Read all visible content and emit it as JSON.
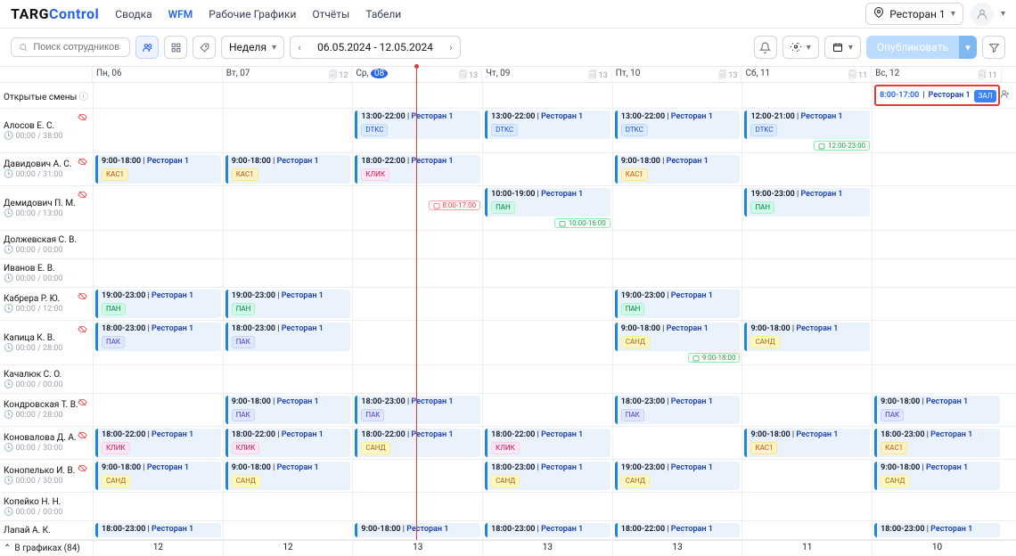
{
  "brand_main": "TARG",
  "brand_accent": "Control",
  "nav": [
    "Сводка",
    "WFM",
    "Рабочие Графики",
    "Отчёты",
    "Табели"
  ],
  "active_nav": 1,
  "location": "Ресторан 1",
  "search_placeholder": "Поиск сотрудников",
  "period_label": "Неделя",
  "date_range": "06.05.2024 - 12.05.2024",
  "publish_label": "Опубликовать",
  "day_headers": [
    {
      "label": "Пн, 06",
      "count": ""
    },
    {
      "label": "Вт, 07",
      "count": "12"
    },
    {
      "label": "Ср, 08",
      "count": "13",
      "today": true
    },
    {
      "label": "Чт, 09",
      "count": "13"
    },
    {
      "label": "Пт, 10",
      "count": "13"
    },
    {
      "label": "Сб, 11",
      "count": "11"
    },
    {
      "label": "Вс, 12",
      "count": "11"
    }
  ],
  "open_shifts_label": "Открытые смены",
  "open_shift": {
    "time": "8:00-17:00",
    "loc": "Ресторан 1",
    "tag": "ЗАЛ"
  },
  "footer_label": "В графиках (84)",
  "footer_counts": [
    "12",
    "12",
    "13",
    "13",
    "13",
    "11",
    "10"
  ],
  "employees": [
    {
      "name": "Алосов Е. С.",
      "hours": "00:00 / 38:00",
      "eye": true,
      "shifts": [
        null,
        null,
        {
          "t": "13:00-22:00",
          "tag": "DTKC"
        },
        {
          "t": "13:00-22:00",
          "tag": "DTKC"
        },
        {
          "t": "13:00-22:00",
          "tag": "DTKC"
        },
        {
          "t": "12:00-21:00",
          "tag": "DTKC",
          "note": "12:00-23:00",
          "note_kind": "green"
        },
        null
      ]
    },
    {
      "name": "Давидович А. С.",
      "hours": "00:00 / 31:00",
      "eye": true,
      "shifts": [
        {
          "t": "9:00-18:00",
          "tag": "КАС1"
        },
        {
          "t": "9:00-18:00",
          "tag": "КАС1"
        },
        {
          "t": "18:00-22:00",
          "tag": "КЛИК"
        },
        null,
        {
          "t": "9:00-18:00",
          "tag": "КАС1"
        },
        null,
        null
      ]
    },
    {
      "name": "Демидович П. М.",
      "hours": "00:00 / 13:00",
      "eye": true,
      "shifts": [
        null,
        null,
        {
          "note_only": "8:00-17:00",
          "note_kind": "red"
        },
        {
          "t": "10:00-19:00",
          "tag": "ПАН",
          "note": "10:00-16:00",
          "note_kind": "green"
        },
        null,
        {
          "t": "19:00-23:00",
          "tag": "ПАН"
        },
        null
      ]
    },
    {
      "name": "Должевская С. В.",
      "hours": "00:00 / 00:00",
      "shifts": [
        null,
        null,
        null,
        null,
        null,
        null,
        null
      ]
    },
    {
      "name": "Иванов Е. В.",
      "hours": "00:00 / 00:00",
      "shifts": [
        null,
        null,
        null,
        null,
        null,
        null,
        null
      ]
    },
    {
      "name": "Кабрера Р. Ю.",
      "hours": "00:00 / 12:00",
      "eye": true,
      "shifts": [
        {
          "t": "19:00-23:00",
          "tag": "ПАН"
        },
        {
          "t": "19:00-23:00",
          "tag": "ПАН"
        },
        null,
        null,
        {
          "t": "19:00-23:00",
          "tag": "ПАН"
        },
        null,
        null
      ]
    },
    {
      "name": "Капица К. В.",
      "hours": "00:00 / 28:00",
      "eye": true,
      "shifts": [
        {
          "t": "18:00-23:00",
          "tag": "ПАК"
        },
        {
          "t": "18:00-23:00",
          "tag": "ПАК"
        },
        null,
        null,
        {
          "t": "9:00-18:00",
          "tag": "САНД",
          "note": "9:00-18:00",
          "note_kind": "green"
        },
        {
          "t": "9:00-18:00",
          "tag": "САНД"
        },
        null
      ]
    },
    {
      "name": "Качалюк С. О.",
      "hours": "00:00 / 00:00",
      "shifts": [
        null,
        null,
        null,
        null,
        null,
        null,
        null
      ]
    },
    {
      "name": "Кондровская Т. В.",
      "hours": "00:00 / 28:00",
      "eye": true,
      "shifts": [
        null,
        {
          "t": "9:00-18:00",
          "tag": "ПАК"
        },
        {
          "t": "18:00-23:00",
          "tag": "ПАК"
        },
        null,
        {
          "t": "18:00-23:00",
          "tag": "ПАК"
        },
        null,
        {
          "t": "9:00-18:00",
          "tag": "ПАК"
        }
      ]
    },
    {
      "name": "Коновалова Д. А.",
      "hours": "00:00 / 30:00",
      "eye": true,
      "shifts": [
        {
          "t": "18:00-22:00",
          "tag": "КЛИК"
        },
        {
          "t": "18:00-22:00",
          "tag": "КЛИК"
        },
        {
          "t": "18:00-22:00",
          "tag": "САНД"
        },
        {
          "t": "18:00-22:00",
          "tag": "КЛИК"
        },
        null,
        {
          "t": "9:00-18:00",
          "tag": "КАС1"
        },
        {
          "t": "18:00-23:00",
          "tag": "КАС1"
        }
      ]
    },
    {
      "name": "Конопелько И. В.",
      "hours": "00:00 / 30:00",
      "eye": true,
      "shifts": [
        {
          "t": "9:00-18:00",
          "tag": "САНД"
        },
        {
          "t": "9:00-18:00",
          "tag": "САНД"
        },
        null,
        {
          "t": "18:00-23:00",
          "tag": "САНД"
        },
        {
          "t": "19:00-23:00",
          "tag": "САНД"
        },
        null,
        {
          "t": "9:00-18:00",
          "tag": "САНД"
        }
      ]
    },
    {
      "name": "Копейко Н. Н.",
      "hours": "00:00 / 00:00",
      "shifts": [
        null,
        null,
        null,
        null,
        null,
        null,
        null
      ]
    },
    {
      "name": "Лапай А. К.",
      "shifts": [
        {
          "t": "18:00-23:00"
        },
        null,
        {
          "t": "9:00-18:00"
        },
        {
          "t": "18:00-23:00"
        },
        {
          "t": "18:00-22:00"
        },
        null,
        {
          "t": "18:00-23:00"
        }
      ],
      "thin": true
    }
  ],
  "loc_name": "Ресторан 1",
  "tag_classes": {
    "DTKC": "tag-dtkc",
    "КАС1": "tag-kac1",
    "КЛИК": "tag-klik",
    "ПАН": "tag-pan",
    "ПАК": "tag-pak",
    "САНД": "tag-sand",
    "ЗАЛ": "tag-zal"
  }
}
